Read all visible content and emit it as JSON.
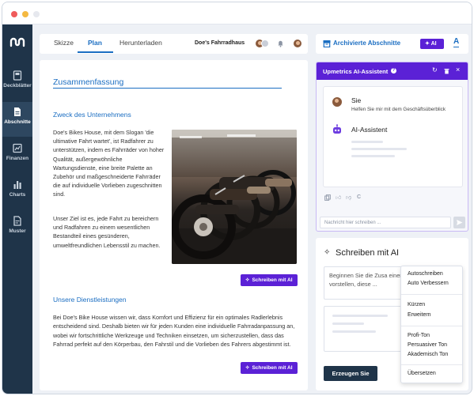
{
  "window": {
    "dots": [
      "#ef5b5b",
      "#f4b942",
      "#e6e8ee"
    ]
  },
  "sidebar": {
    "items": [
      {
        "label": "Deckblätter"
      },
      {
        "label": "Abschnitte"
      },
      {
        "label": "Finanzen"
      },
      {
        "label": "Charts"
      },
      {
        "label": "Muster"
      }
    ],
    "active": "Abschnitte"
  },
  "toolbar": {
    "tabs": [
      "Skizze",
      "Plan",
      "Herunterladen"
    ],
    "active_tab": "Plan",
    "project_name": "Doe's Fahrradhaus"
  },
  "document": {
    "heading": "Zusammenfassung",
    "section1_title": "Zweck des Unternehmens",
    "para1": "Doe's Bikes House, mit dem Slogan 'die ultimative Fahrt wartet', ist Radfahrer zu unterstützen, indem es Fahrräder von hoher Qualität, außergewöhnliche Wartungsdienste, eine breite Palette an Zubehör und maßgeschneiderte Fahrräder die auf individuelle Vorlieben zugeschnitten sind.",
    "para2": "Unser Ziel ist es, jede Fahrt zu bereichern und Radfahren zu einem wesentlichen Bestandteil eines gesünderen, umweltfreundlichen Lebensstil zu machen.",
    "write_ai_label": "Schreiben mit AI",
    "section2_title": "Unsere Dienstleistungen",
    "para3": "Bei Doe's Bike House wissen wir, dass Komfort und Effizienz für ein optimales Radlerlebnis entscheidend sind. Deshalb bieten wir für jeden Kunden eine individuelle Fahrradanpassung an, wobei wir fortschrittliche Werkzeuge und Techniken einsetzen, um sicherzustellen, dass das Fahrrad perfekt auf den Körperbau, den Fahrstil und die Vorlieben des Fahrers abgestimmt ist."
  },
  "right_panel": {
    "archived_label": "Archivierte Abschnitte",
    "ai_button": "AI",
    "font_button": "A"
  },
  "assistant": {
    "title": "Upmetrics AI-Assistent",
    "user_name": "Sie",
    "user_message": "Helfen Sie mir mit dem Geschäftsüberblick",
    "bot_name": "AI-Assistent",
    "reaction_c": "C",
    "input_placeholder": "Nachricht hier schreiben ..."
  },
  "writer": {
    "title": "Schreiben mit AI",
    "prompt_text": "Beginnen Sie die Zusa einer kurzen Ihr Untern vorstellen, diese ...",
    "generate_label": "Erzeugen Sie"
  },
  "menu": {
    "groups": [
      [
        "Autoschreiben",
        "Auto Verbessern"
      ],
      [
        "Kürzen",
        "Erweitern"
      ],
      [
        "Profi-Ton",
        "Persuasiver Ton",
        "Akademisch Ton"
      ],
      [
        "Übersetzen"
      ]
    ]
  },
  "colors": {
    "accent": "#1b6ec2",
    "ai_purple": "#5b21d6",
    "sidebar": "#1f3449"
  }
}
